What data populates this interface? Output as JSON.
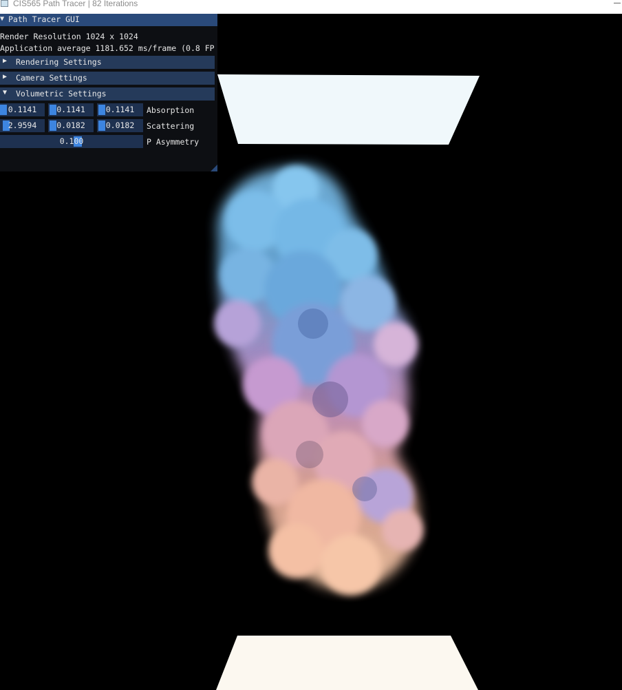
{
  "window": {
    "title": "CIS565 Path Tracer | 82 Iterations",
    "icon": "app-window-icon"
  },
  "gui": {
    "title": "Path Tracer GUI",
    "resolution_text": "Render Resolution 1024 x 1024",
    "fps_text": "Application average 1181.652 ms/frame (0.8 FP",
    "sections": {
      "rendering": "Rendering Settings",
      "camera": "Camera Settings",
      "volumetric": "Volumetric Settings"
    },
    "volumetric": {
      "absorption_label": "Absorption",
      "absorption": [
        "0.1141",
        "0.1141",
        "0.1141"
      ],
      "scattering_label": "Scattering",
      "scattering": [
        "2.9594",
        "0.0182",
        "0.0182"
      ],
      "asymmetry_label": "P Asymmetry",
      "asymmetry": "0.100"
    },
    "colors": {
      "title_bg": "#2a4a7a",
      "header_bg": "#253a5a",
      "field_bg": "#1e3150",
      "grab": "#3d85e0"
    }
  },
  "scene": {
    "top_light_color": "#f0f8fb",
    "bottom_light_color": "#fcf8f0",
    "smoke_colors": [
      "#6cb4e4",
      "#c49ad0",
      "#ecb0a0",
      "#f6c4a4"
    ]
  }
}
